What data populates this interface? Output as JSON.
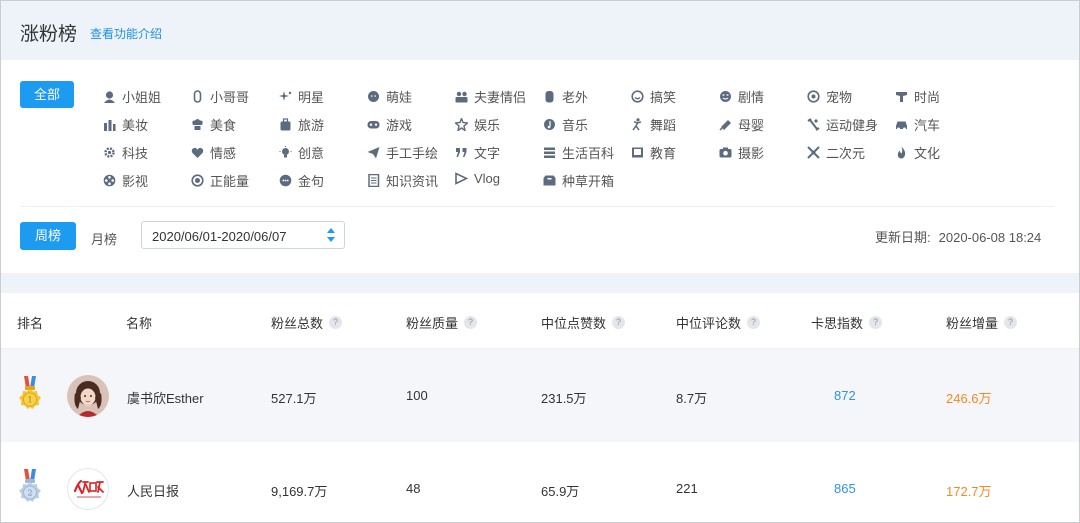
{
  "header": {
    "title": "涨粉榜",
    "help_link": "查看功能介绍"
  },
  "filter": {
    "all_label": "全部",
    "categories": [
      {
        "label": "小姐姐",
        "icon": "girl-icon"
      },
      {
        "label": "小哥哥",
        "icon": "boy-icon"
      },
      {
        "label": "明星",
        "icon": "star-sparkle-icon"
      },
      {
        "label": "萌娃",
        "icon": "baby-icon"
      },
      {
        "label": "夫妻情侣",
        "icon": "couple-icon"
      },
      {
        "label": "老外",
        "icon": "foreigner-icon"
      },
      {
        "label": "搞笑",
        "icon": "smile-icon"
      },
      {
        "label": "剧情",
        "icon": "drama-face-icon"
      },
      {
        "label": "宠物",
        "icon": "pet-icon"
      },
      {
        "label": "时尚",
        "icon": "fashion-icon"
      },
      {
        "label": "美妆",
        "icon": "makeup-icon"
      },
      {
        "label": "美食",
        "icon": "chef-hat-icon"
      },
      {
        "label": "旅游",
        "icon": "luggage-icon"
      },
      {
        "label": "游戏",
        "icon": "gamepad-icon"
      },
      {
        "label": "娱乐",
        "icon": "entertainment-icon"
      },
      {
        "label": "音乐",
        "icon": "music-note-icon"
      },
      {
        "label": "舞蹈",
        "icon": "dance-icon"
      },
      {
        "label": "母婴",
        "icon": "baby-bottle-icon"
      },
      {
        "label": "运动健身",
        "icon": "fitness-icon"
      },
      {
        "label": "汽车",
        "icon": "car-icon"
      },
      {
        "label": "科技",
        "icon": "gear-icon"
      },
      {
        "label": "情感",
        "icon": "heart-icon"
      },
      {
        "label": "创意",
        "icon": "lightbulb-icon"
      },
      {
        "label": "手工手绘",
        "icon": "paper-plane-icon"
      },
      {
        "label": "文字",
        "icon": "quote-icon"
      },
      {
        "label": "生活百科",
        "icon": "list-icon"
      },
      {
        "label": "教育",
        "icon": "book-icon"
      },
      {
        "label": "摄影",
        "icon": "camera-icon"
      },
      {
        "label": "二次元",
        "icon": "anime-icon"
      },
      {
        "label": "文化",
        "icon": "flame-icon"
      },
      {
        "label": "影视",
        "icon": "film-reel-icon"
      },
      {
        "label": "正能量",
        "icon": "sun-icon"
      },
      {
        "label": "金句",
        "icon": "chat-bubble-icon"
      },
      {
        "label": "知识资讯",
        "icon": "document-icon"
      },
      {
        "label": "Vlog",
        "icon": "vlog-icon"
      },
      {
        "label": "种草开箱",
        "icon": "box-icon"
      }
    ]
  },
  "period": {
    "week_label": "周榜",
    "month_label": "月榜",
    "date_range": "2020/06/01-2020/06/07",
    "update_label": "更新日期:",
    "update_value": "2020-06-08 18:24"
  },
  "table": {
    "headers": {
      "rank": "排名",
      "name": "名称",
      "total_fans": "粉丝总数",
      "fan_quality": "粉丝质量",
      "median_likes": "中位点赞数",
      "median_comments": "中位评论数",
      "kasi_index": "卡思指数",
      "fan_growth": "粉丝增量"
    },
    "help_mark": "?",
    "rows": [
      {
        "rank": "1",
        "name": "虞书欣Esther",
        "total_fans": "527.1万",
        "fan_quality": "100",
        "median_likes": "231.5万",
        "median_comments": "8.7万",
        "kasi_index": "872",
        "fan_growth": "246.6万"
      },
      {
        "rank": "2",
        "name": "人民日报",
        "total_fans": "9,169.7万",
        "fan_quality": "48",
        "median_likes": "65.9万",
        "median_comments": "221",
        "kasi_index": "865",
        "fan_growth": "172.7万"
      }
    ]
  },
  "colors": {
    "accent": "#1d9bf0",
    "header_bg": "#eef3fa",
    "kasi_blue": "#2f93e6",
    "growth_orange": "#f58a24",
    "gold_medal": "#f4c430",
    "silver_medal": "#b9cfe6"
  }
}
